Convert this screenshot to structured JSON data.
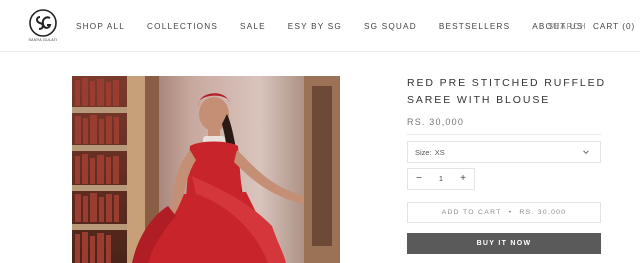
{
  "header": {
    "logo_text": "SANYA GULATI",
    "nav_items": [
      "SHOP ALL",
      "COLLECTIONS",
      "SALE",
      "ESY BY SG",
      "SG SQUAD",
      "BESTSELLERS",
      "ABOUT US"
    ],
    "search_label": "SEARCH",
    "cart_label": "CART (0)"
  },
  "product": {
    "title": "RED PRE STITCHED RUFFLED SAREE WITH BLOUSE",
    "price": "RS. 30,000",
    "size_prefix": "Size:",
    "size_value": "XS",
    "quantity": "1",
    "qty_minus": "−",
    "qty_plus": "+",
    "add_to_cart_label": "ADD TO CART",
    "add_to_cart_separator": "•",
    "add_to_cart_price": "RS. 30,000",
    "buy_now_label": "BUY IT NOW"
  },
  "colors": {
    "buy_button_bg": "#5a5a5a",
    "saree_red": "#c8242b"
  },
  "icons": {
    "size_dropdown": "chevron-down-icon",
    "logo": "sg-monogram-icon"
  }
}
